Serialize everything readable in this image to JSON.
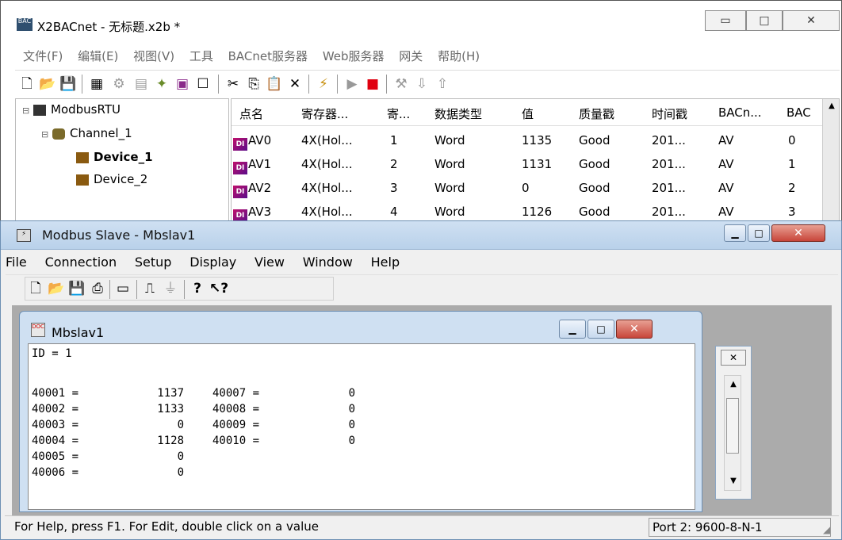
{
  "app": {
    "title": "X2BACnet - 无标题.x2b *",
    "icon_text": "BAC",
    "menus": [
      "文件(F)",
      "编辑(E)",
      "视图(V)",
      "工具",
      "BACnet服务器",
      "Web服务器",
      "网关",
      "帮助(H)"
    ],
    "caption_buttons": {
      "minimize": "▭",
      "maximize": "□",
      "close": "✕"
    },
    "tree": {
      "root": "ModbusRTU",
      "channel": "Channel_1",
      "devices": [
        "Device_1",
        "Device_2"
      ]
    },
    "grid": {
      "headers": [
        "点名",
        "寄存器...",
        "寄...",
        "数据类型",
        "值",
        "质量戳",
        "时间戳",
        "BACn...",
        "BAC"
      ],
      "rows": [
        [
          "AV0",
          "4X(Hol...",
          "1",
          "Word",
          "1135",
          "Good",
          "201...",
          "AV",
          "0"
        ],
        [
          "AV1",
          "4X(Hol...",
          "2",
          "Word",
          "1131",
          "Good",
          "201...",
          "AV",
          "1"
        ],
        [
          "AV2",
          "4X(Hol...",
          "3",
          "Word",
          "0",
          "Good",
          "201...",
          "AV",
          "2"
        ],
        [
          "AV3",
          "4X(Hol...",
          "4",
          "Word",
          "1126",
          "Good",
          "201...",
          "AV",
          "3"
        ]
      ],
      "row_icon": "DI"
    }
  },
  "slave": {
    "title": "Modbus Slave - Mbslav1",
    "menus": [
      "File",
      "Connection",
      "Setup",
      "Display",
      "View",
      "Window",
      "Help"
    ],
    "child_title": "Mbslav1",
    "id_line": "ID = 1",
    "registers_left": [
      {
        "addr": "40001 =",
        "val": "1137"
      },
      {
        "addr": "40002 =",
        "val": "1133"
      },
      {
        "addr": "40003 =",
        "val": "0"
      },
      {
        "addr": "40004 =",
        "val": "1128"
      },
      {
        "addr": "40005 =",
        "val": "0"
      },
      {
        "addr": "40006 =",
        "val": "0"
      }
    ],
    "registers_right": [
      {
        "addr": "40007 =",
        "val": "0"
      },
      {
        "addr": "40008 =",
        "val": "0"
      },
      {
        "addr": "40009 =",
        "val": "0"
      },
      {
        "addr": "40010 =",
        "val": "0"
      }
    ],
    "status_text": "For Help, press F1.  For Edit, double click on a value",
    "status_port": "Port 2: 9600-8-N-1",
    "close_color": "#c8453a"
  }
}
